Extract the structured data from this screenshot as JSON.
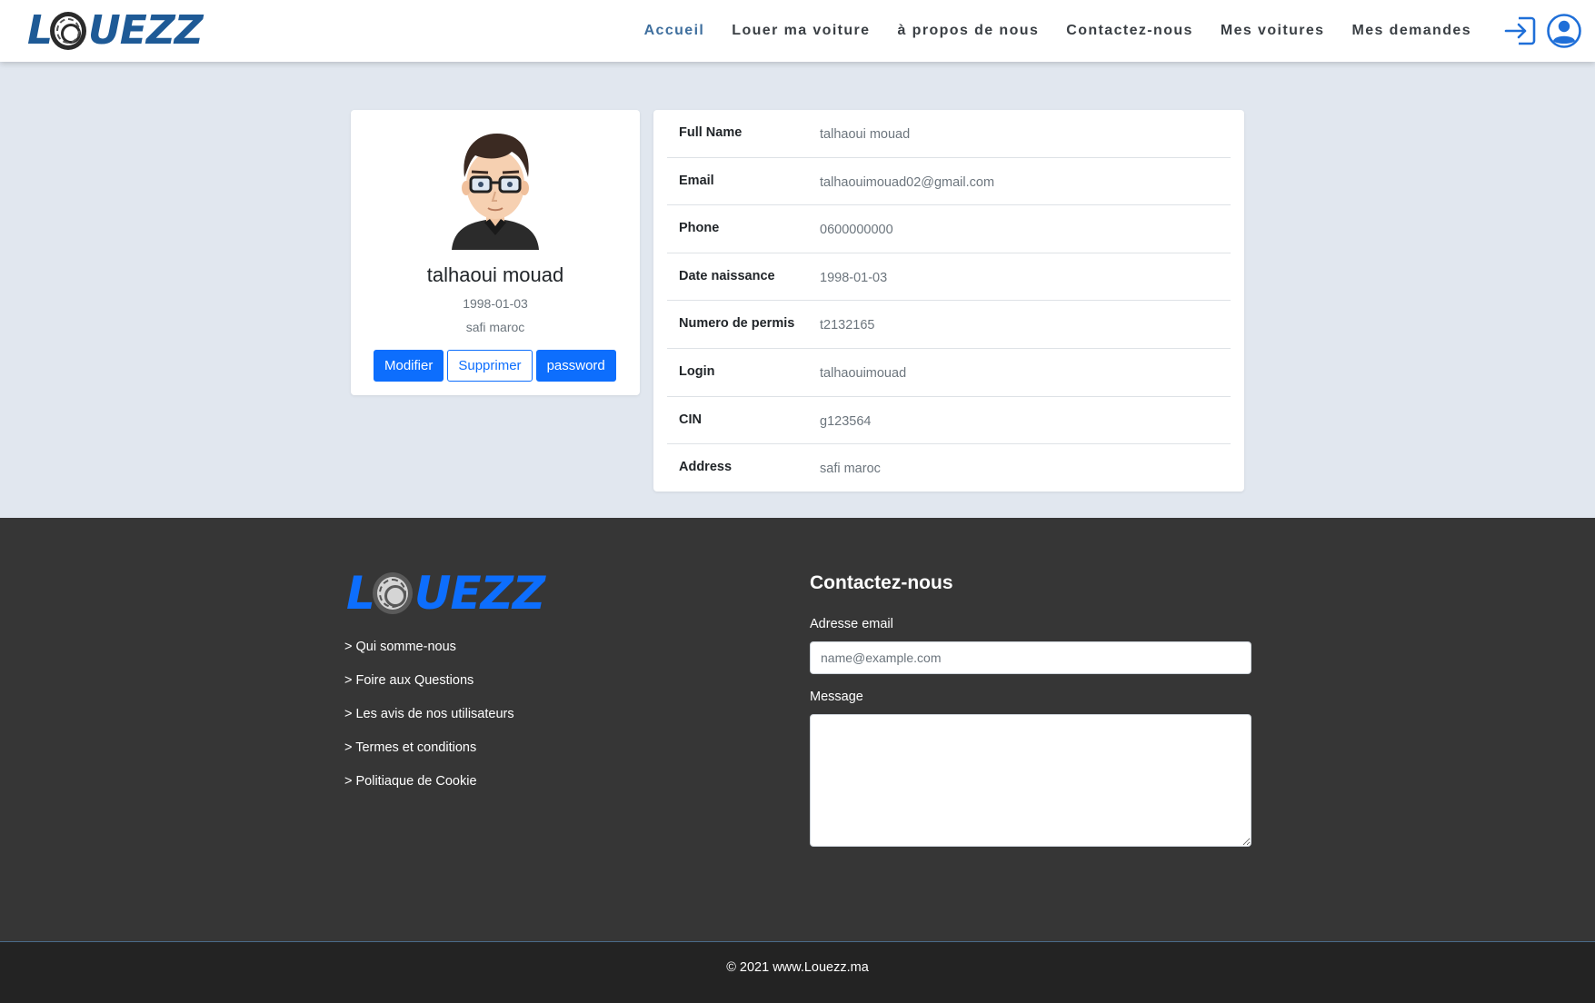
{
  "brand": {
    "logo_first": "L",
    "logo_rest": "UEZZ",
    "accent_color": "#1e5a96",
    "footer_logo_color": "#0d6efd"
  },
  "nav": {
    "items": [
      {
        "label": "Accueil",
        "active": true
      },
      {
        "label": "Louer ma voiture",
        "active": false
      },
      {
        "label": "à propos de nous",
        "active": false
      },
      {
        "label": "Contactez-nous",
        "active": false
      },
      {
        "label": "Mes voitures",
        "active": false
      },
      {
        "label": "Mes demandes",
        "active": false
      }
    ],
    "icons": [
      "login-icon",
      "user-account-icon"
    ]
  },
  "profile": {
    "name": "talhaoui mouad",
    "dob": "1998-01-03",
    "city": "safi maroc",
    "buttons": {
      "modify": "Modifier",
      "delete": "Supprimer",
      "password": "password"
    }
  },
  "details": [
    {
      "label": "Full Name",
      "value": "talhaoui mouad"
    },
    {
      "label": "Email",
      "value": "talhaouimouad02@gmail.com"
    },
    {
      "label": "Phone",
      "value": "0600000000"
    },
    {
      "label": "Date naissance",
      "value": "1998-01-03"
    },
    {
      "label": "Numero de permis",
      "value": "t2132165"
    },
    {
      "label": "Login",
      "value": "talhaouimouad"
    },
    {
      "label": "CIN",
      "value": "g123564"
    },
    {
      "label": "Address",
      "value": "safi maroc"
    }
  ],
  "footer": {
    "links": [
      "> Qui somme-nous",
      "> Foire aux Questions",
      "> Les avis de nos utilisateurs",
      "> Termes et conditions",
      "> Politiaque de Cookie"
    ],
    "contact": {
      "title": "Contactez-nous",
      "email_label": "Adresse email",
      "email_placeholder": "name@example.com",
      "message_label": "Message"
    },
    "copyright": "© 2021 www.Louezz.ma"
  }
}
